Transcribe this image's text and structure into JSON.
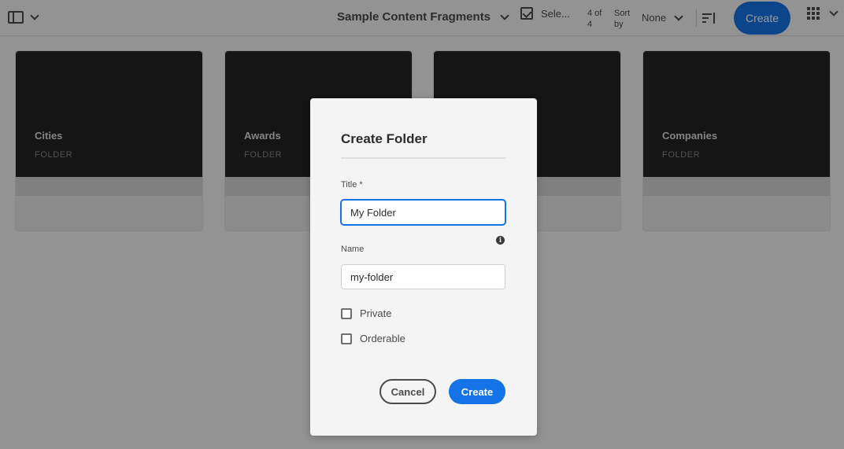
{
  "toolbar": {
    "folder_title": "Sample Content Fragments",
    "select_label": "Sele...",
    "count_text": "4 of 4",
    "sort_by_label": "Sort by",
    "sort_value": "None",
    "create_label": "Create"
  },
  "cards": [
    {
      "title": "Cities",
      "type": "FOLDER"
    },
    {
      "title": "Awards",
      "type": "FOLDER"
    },
    {
      "title": "",
      "type": ""
    },
    {
      "title": "Companies",
      "type": "FOLDER"
    }
  ],
  "dialog": {
    "heading": "Create Folder",
    "title_label": "Title *",
    "title_value": "My Folder",
    "name_label": "Name",
    "name_value": "my-folder",
    "private_label": "Private",
    "orderable_label": "Orderable",
    "cancel_label": "Cancel",
    "create_label": "Create"
  },
  "colors": {
    "accent": "#1473e6",
    "card_thumb": "#232323"
  }
}
